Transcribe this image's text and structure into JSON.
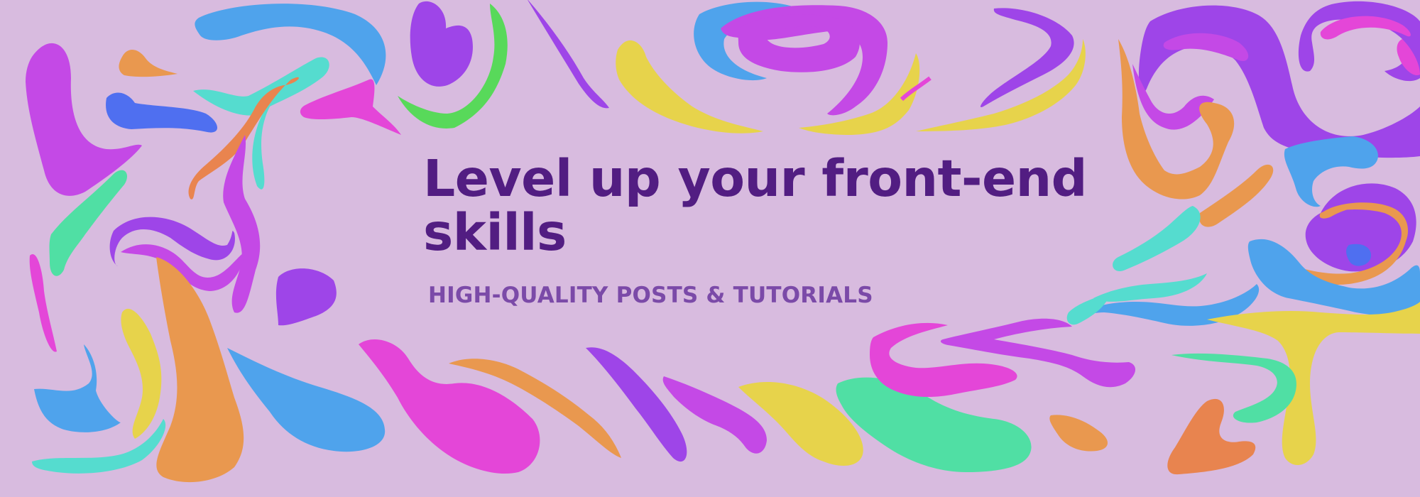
{
  "banner": {
    "headline": "Level up your front-end skills",
    "tagline": "HIGH-QUALITY POSTS & TUTORIALS"
  },
  "colors": {
    "background": "#d8bbdf",
    "headline": "#521d82",
    "tagline": "#7b4aa8",
    "shape_palette": [
      "#c449e6",
      "#4fa3ec",
      "#e9984f",
      "#50dfa4",
      "#e7d34b",
      "#e446d8",
      "#9e45e8",
      "#55dccf",
      "#4f6ff0",
      "#58d95a",
      "#e8844f"
    ]
  }
}
